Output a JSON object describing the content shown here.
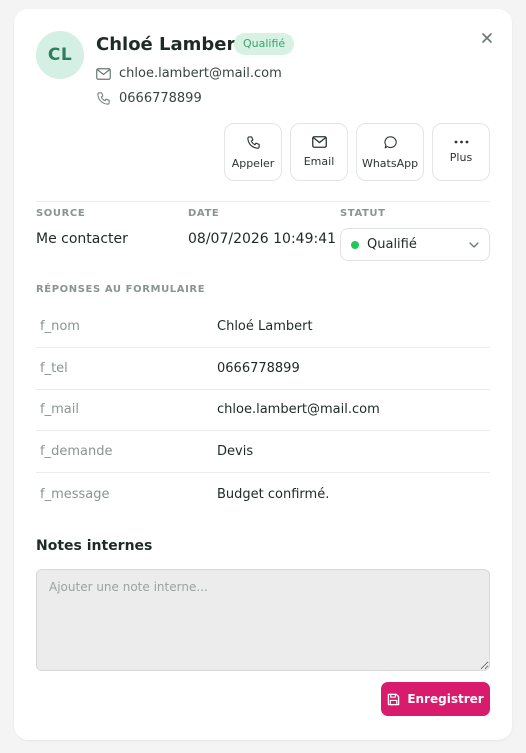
{
  "contact": {
    "initials": "CL",
    "name": "Chloé Lambert",
    "status_badge": "Qualifié",
    "email": "chloe.lambert@mail.com",
    "phone": "0666778899"
  },
  "actions": [
    {
      "label": "Appeler",
      "icon": "phone-icon"
    },
    {
      "label": "Email",
      "icon": "mail-icon"
    },
    {
      "label": "WhatsApp",
      "icon": "chat-bubble-icon"
    },
    {
      "label": "Plus",
      "icon": "more-horizontal-icon"
    }
  ],
  "meta": {
    "source_label": "SOURCE",
    "source_value": "Me contacter",
    "date_label": "DATE",
    "date_value": "08/07/2026 10:49:41",
    "status_label": "STATUT",
    "status_value": "Qualifié",
    "status_color": "#22c55e"
  },
  "form": {
    "section_label": "RÉPONSES AU FORMULAIRE",
    "rows": [
      {
        "key": "f_nom",
        "value": "Chloé Lambert"
      },
      {
        "key": "f_tel",
        "value": "0666778899"
      },
      {
        "key": "f_mail",
        "value": "chloe.lambert@mail.com"
      },
      {
        "key": "f_demande",
        "value": "Devis"
      },
      {
        "key": "f_message",
        "value": "Budget confirmé."
      }
    ]
  },
  "notes": {
    "title": "Notes internes",
    "placeholder": "Ajouter une note interne...",
    "value": ""
  },
  "save_label": "Enregistrer",
  "colors": {
    "accent": "#d81b6c",
    "badge_bg": "#d7f2e3",
    "badge_text": "#3aa36b",
    "avatar_bg": "#d4efe3"
  }
}
